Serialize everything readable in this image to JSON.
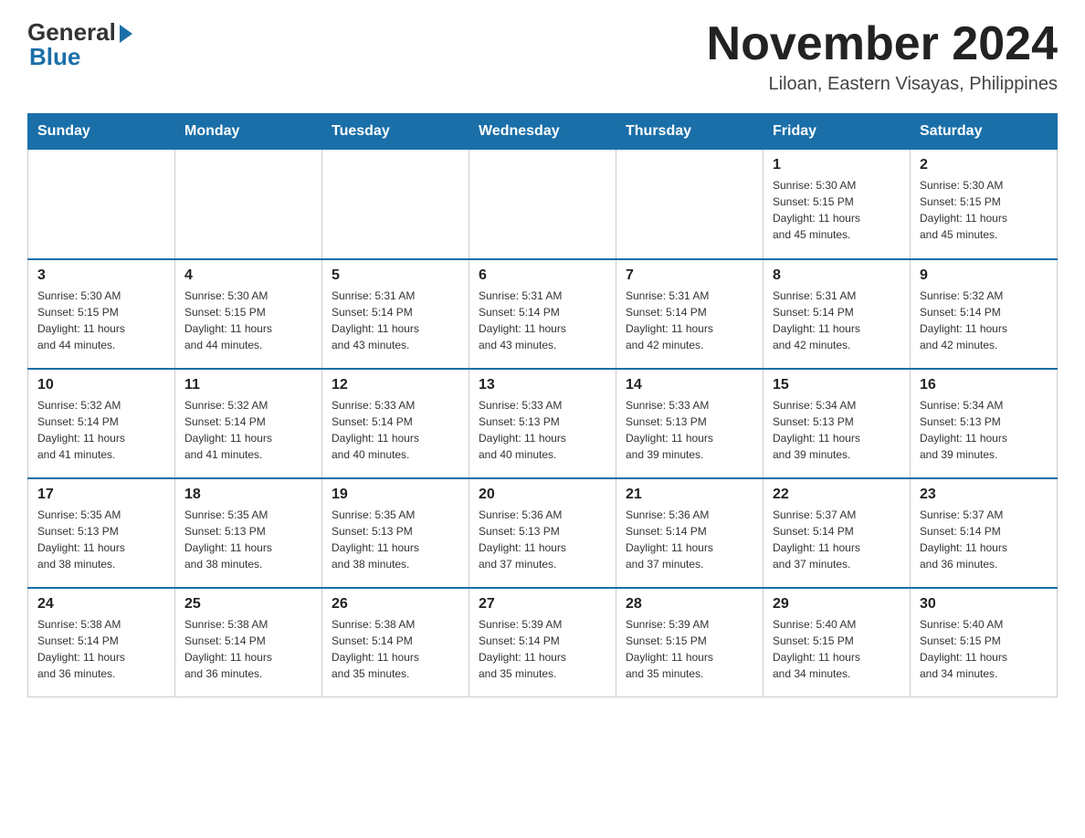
{
  "header": {
    "logo_general": "General",
    "logo_blue": "Blue",
    "main_title": "November 2024",
    "subtitle": "Liloan, Eastern Visayas, Philippines"
  },
  "calendar": {
    "days_of_week": [
      "Sunday",
      "Monday",
      "Tuesday",
      "Wednesday",
      "Thursday",
      "Friday",
      "Saturday"
    ],
    "weeks": [
      [
        {
          "day": "",
          "info": ""
        },
        {
          "day": "",
          "info": ""
        },
        {
          "day": "",
          "info": ""
        },
        {
          "day": "",
          "info": ""
        },
        {
          "day": "",
          "info": ""
        },
        {
          "day": "1",
          "info": "Sunrise: 5:30 AM\nSunset: 5:15 PM\nDaylight: 11 hours\nand 45 minutes."
        },
        {
          "day": "2",
          "info": "Sunrise: 5:30 AM\nSunset: 5:15 PM\nDaylight: 11 hours\nand 45 minutes."
        }
      ],
      [
        {
          "day": "3",
          "info": "Sunrise: 5:30 AM\nSunset: 5:15 PM\nDaylight: 11 hours\nand 44 minutes."
        },
        {
          "day": "4",
          "info": "Sunrise: 5:30 AM\nSunset: 5:15 PM\nDaylight: 11 hours\nand 44 minutes."
        },
        {
          "day": "5",
          "info": "Sunrise: 5:31 AM\nSunset: 5:14 PM\nDaylight: 11 hours\nand 43 minutes."
        },
        {
          "day": "6",
          "info": "Sunrise: 5:31 AM\nSunset: 5:14 PM\nDaylight: 11 hours\nand 43 minutes."
        },
        {
          "day": "7",
          "info": "Sunrise: 5:31 AM\nSunset: 5:14 PM\nDaylight: 11 hours\nand 42 minutes."
        },
        {
          "day": "8",
          "info": "Sunrise: 5:31 AM\nSunset: 5:14 PM\nDaylight: 11 hours\nand 42 minutes."
        },
        {
          "day": "9",
          "info": "Sunrise: 5:32 AM\nSunset: 5:14 PM\nDaylight: 11 hours\nand 42 minutes."
        }
      ],
      [
        {
          "day": "10",
          "info": "Sunrise: 5:32 AM\nSunset: 5:14 PM\nDaylight: 11 hours\nand 41 minutes."
        },
        {
          "day": "11",
          "info": "Sunrise: 5:32 AM\nSunset: 5:14 PM\nDaylight: 11 hours\nand 41 minutes."
        },
        {
          "day": "12",
          "info": "Sunrise: 5:33 AM\nSunset: 5:14 PM\nDaylight: 11 hours\nand 40 minutes."
        },
        {
          "day": "13",
          "info": "Sunrise: 5:33 AM\nSunset: 5:13 PM\nDaylight: 11 hours\nand 40 minutes."
        },
        {
          "day": "14",
          "info": "Sunrise: 5:33 AM\nSunset: 5:13 PM\nDaylight: 11 hours\nand 39 minutes."
        },
        {
          "day": "15",
          "info": "Sunrise: 5:34 AM\nSunset: 5:13 PM\nDaylight: 11 hours\nand 39 minutes."
        },
        {
          "day": "16",
          "info": "Sunrise: 5:34 AM\nSunset: 5:13 PM\nDaylight: 11 hours\nand 39 minutes."
        }
      ],
      [
        {
          "day": "17",
          "info": "Sunrise: 5:35 AM\nSunset: 5:13 PM\nDaylight: 11 hours\nand 38 minutes."
        },
        {
          "day": "18",
          "info": "Sunrise: 5:35 AM\nSunset: 5:13 PM\nDaylight: 11 hours\nand 38 minutes."
        },
        {
          "day": "19",
          "info": "Sunrise: 5:35 AM\nSunset: 5:13 PM\nDaylight: 11 hours\nand 38 minutes."
        },
        {
          "day": "20",
          "info": "Sunrise: 5:36 AM\nSunset: 5:13 PM\nDaylight: 11 hours\nand 37 minutes."
        },
        {
          "day": "21",
          "info": "Sunrise: 5:36 AM\nSunset: 5:14 PM\nDaylight: 11 hours\nand 37 minutes."
        },
        {
          "day": "22",
          "info": "Sunrise: 5:37 AM\nSunset: 5:14 PM\nDaylight: 11 hours\nand 37 minutes."
        },
        {
          "day": "23",
          "info": "Sunrise: 5:37 AM\nSunset: 5:14 PM\nDaylight: 11 hours\nand 36 minutes."
        }
      ],
      [
        {
          "day": "24",
          "info": "Sunrise: 5:38 AM\nSunset: 5:14 PM\nDaylight: 11 hours\nand 36 minutes."
        },
        {
          "day": "25",
          "info": "Sunrise: 5:38 AM\nSunset: 5:14 PM\nDaylight: 11 hours\nand 36 minutes."
        },
        {
          "day": "26",
          "info": "Sunrise: 5:38 AM\nSunset: 5:14 PM\nDaylight: 11 hours\nand 35 minutes."
        },
        {
          "day": "27",
          "info": "Sunrise: 5:39 AM\nSunset: 5:14 PM\nDaylight: 11 hours\nand 35 minutes."
        },
        {
          "day": "28",
          "info": "Sunrise: 5:39 AM\nSunset: 5:15 PM\nDaylight: 11 hours\nand 35 minutes."
        },
        {
          "day": "29",
          "info": "Sunrise: 5:40 AM\nSunset: 5:15 PM\nDaylight: 11 hours\nand 34 minutes."
        },
        {
          "day": "30",
          "info": "Sunrise: 5:40 AM\nSunset: 5:15 PM\nDaylight: 11 hours\nand 34 minutes."
        }
      ]
    ]
  }
}
